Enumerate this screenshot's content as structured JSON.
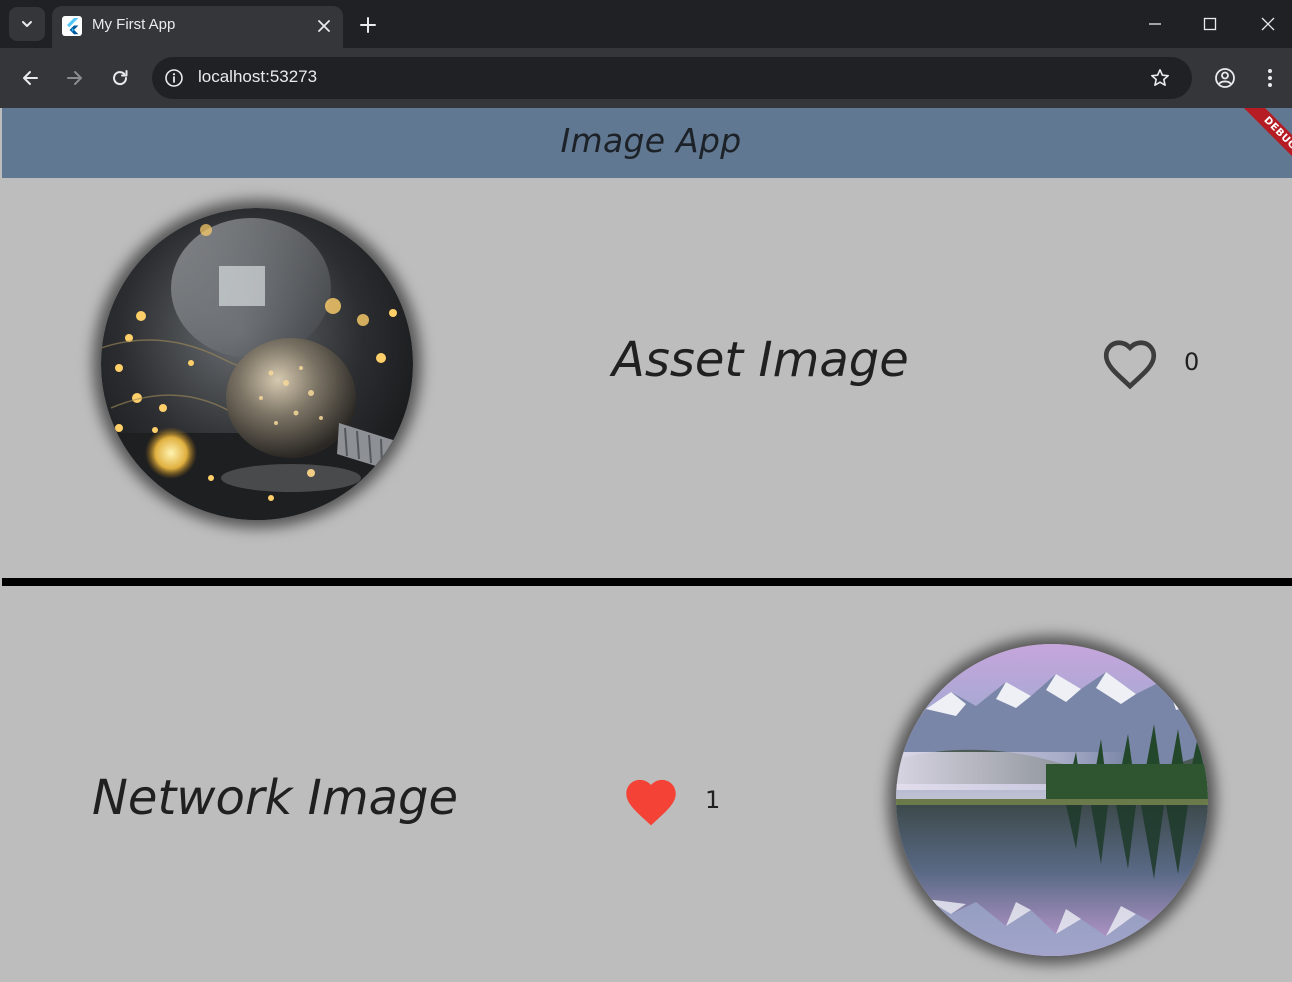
{
  "browser": {
    "tab_title": "My First App",
    "url": "localhost:53273",
    "icons": {
      "tab_search": "chevron-down-icon",
      "favicon": "flutter-logo-icon",
      "close_tab": "close-icon",
      "new_tab": "plus-icon",
      "minimize": "minimize-icon",
      "maximize": "maximize-icon",
      "close_window": "close-icon",
      "back": "arrow-left-icon",
      "forward": "arrow-right-icon",
      "reload": "reload-icon",
      "site_info": "info-icon",
      "bookmark": "star-outline-icon",
      "profile": "account-circle-icon",
      "menu": "more-vert-icon"
    }
  },
  "app": {
    "title": "Image App",
    "debug_banner": "DEBUG",
    "colors": {
      "appbar": "#607891",
      "background": "#bdbdbd",
      "divider": "#000000",
      "heart_liked": "#f44336",
      "heart_unliked": "#3d3d3d"
    },
    "cards": [
      {
        "label": "Asset Image",
        "liked": false,
        "heart_icon": "heart-outline-icon",
        "count": "0",
        "image": "lightbulb-bokeh-photo"
      },
      {
        "label": "Network Image",
        "liked": true,
        "heart_icon": "heart-filled-icon",
        "count": "1",
        "image": "mountain-lake-reflection-photo"
      }
    ]
  }
}
